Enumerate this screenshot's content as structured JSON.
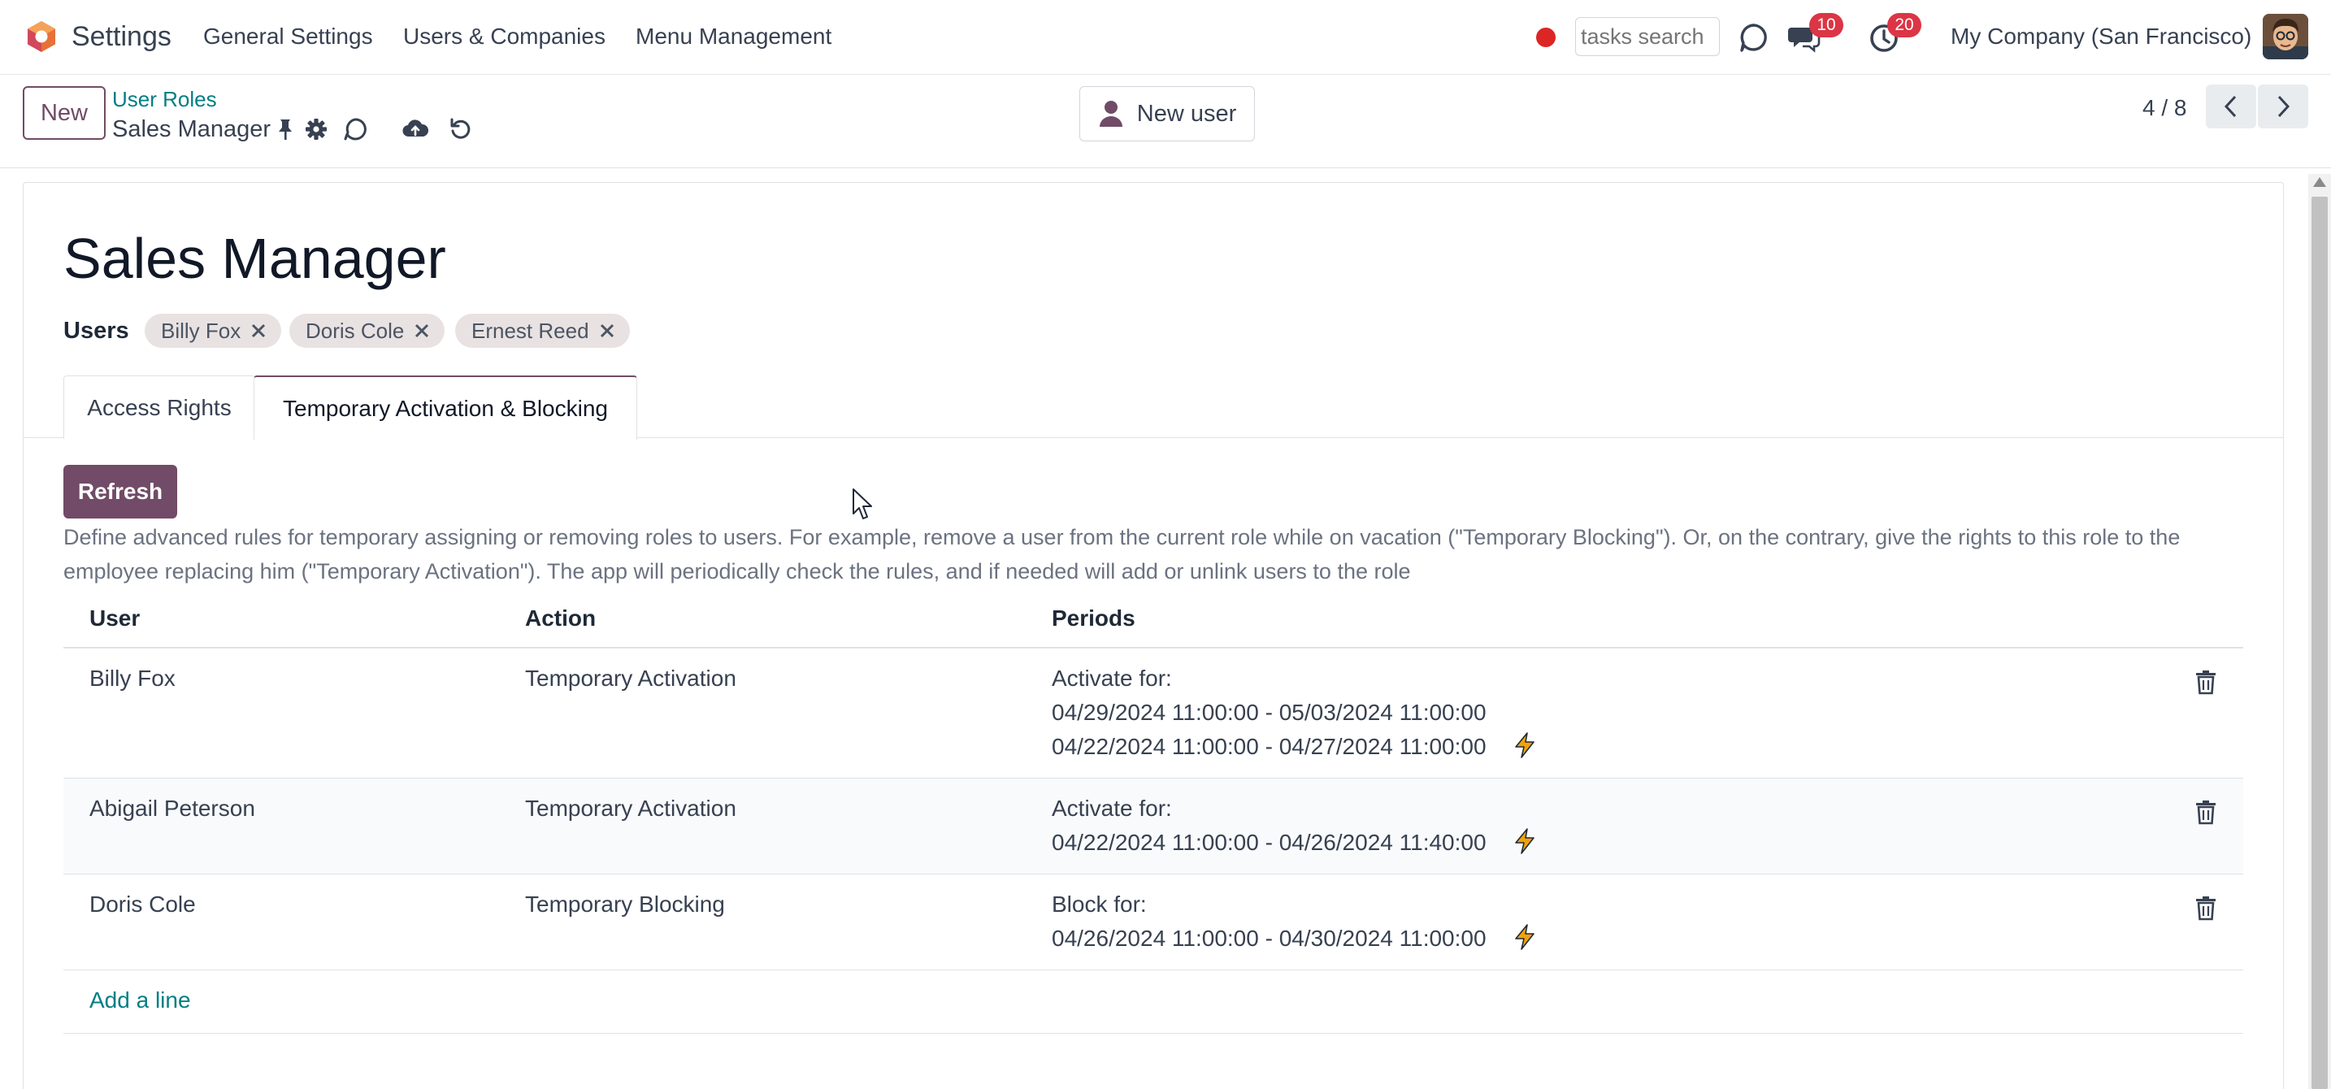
{
  "navbar": {
    "app_name": "Settings",
    "menu": [
      "General Settings",
      "Users & Companies",
      "Menu Management"
    ],
    "search_placeholder": "tasks search",
    "messages_badge": "10",
    "activities_badge": "20",
    "company": "My Company (San Francisco)"
  },
  "control_panel": {
    "new_label": "New",
    "breadcrumb_parent": "User Roles",
    "breadcrumb_current": "Sales Manager",
    "new_user_label": "New user",
    "pager": "4 / 8"
  },
  "form": {
    "title": "Sales Manager",
    "users_label": "Users",
    "user_tags": [
      "Billy Fox",
      "Doris Cole",
      "Ernest Reed"
    ],
    "tabs": [
      "Access Rights",
      "Temporary Activation & Blocking"
    ],
    "active_tab": "Temporary Activation & Blocking",
    "refresh_label": "Refresh",
    "description": "Define advanced rules for temporary assigning or removing roles to users. For example, remove a user from the current role while on vacation (\"Temporary Blocking\"). Or, on the contrary, give the rights to this role to the employee replacing him (\"Temporary Activation\"). The app will periodically check the rules, and if needed will add or unlink users to the role"
  },
  "table": {
    "columns": [
      "User",
      "Action",
      "Periods"
    ],
    "rows": [
      {
        "user": "Billy Fox",
        "action": "Temporary Activation",
        "period_heading": "Activate for:",
        "periods": [
          "04/29/2024 11:00:00 - 05/03/2024 11:00:00",
          "04/22/2024 11:00:00 - 04/27/2024 11:00:00"
        ]
      },
      {
        "user": "Abigail Peterson",
        "action": "Temporary Activation",
        "period_heading": "Activate for:",
        "periods": [
          "04/22/2024 11:00:00 - 04/26/2024 11:40:00"
        ]
      },
      {
        "user": "Doris Cole",
        "action": "Temporary Blocking",
        "period_heading": "Block for:",
        "periods": [
          "04/26/2024 11:00:00 - 04/30/2024 11:00:00"
        ]
      }
    ],
    "add_line_label": "Add a line"
  },
  "colors": {
    "brand": "#714b67",
    "link": "#017e84",
    "badge": "#dc3545",
    "recording": "#dc2626",
    "bolt": "#f0a30a"
  },
  "icons": {
    "pin": "pin-icon",
    "gear": "gear-icon",
    "sync": "sync-icon",
    "save": "cloud-upload-icon",
    "discard": "undo-icon",
    "bolt": "lightning-bolt-icon",
    "trash": "trash-icon"
  }
}
